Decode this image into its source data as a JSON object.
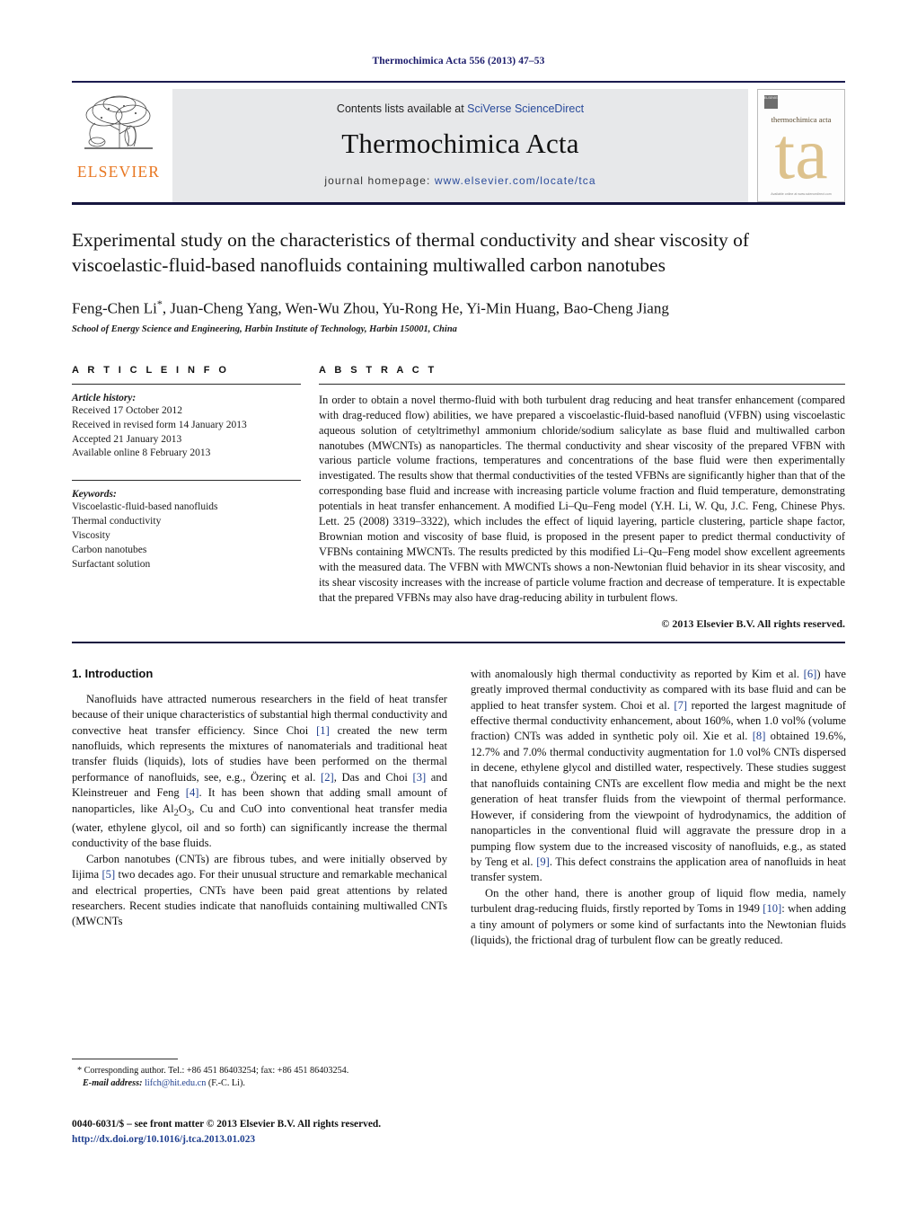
{
  "running_head": "Thermochimica Acta 556 (2013) 47–53",
  "masthead": {
    "publisher_name": "ELSEVIER",
    "publisher_logo_icon": "elsevier-tree-icon",
    "contents_prefix": "Contents lists available at ",
    "contents_link": "SciVerse ScienceDirect",
    "journal_name": "Thermochimica Acta",
    "homepage_prefix": "journal homepage: ",
    "homepage_link": "www.elsevier.com/locate/tca",
    "cover": {
      "badge_text": "ELSEVIER",
      "title": "thermochimica acta",
      "monogram": "ta",
      "footer": "Available online at www.sciencedirect.com"
    }
  },
  "article": {
    "title": "Experimental study on the characteristics of thermal conductivity and shear viscosity of viscoelastic-fluid-based nanofluids containing multiwalled carbon nanotubes",
    "authors": "Feng-Chen Li*, Juan-Cheng Yang, Wen-Wu Zhou, Yu-Rong He, Yi-Min Huang, Bao-Cheng Jiang",
    "affiliation": "School of Energy Science and Engineering, Harbin Institute of Technology, Harbin 150001, China"
  },
  "article_info": {
    "heading": "A R T I C L E   I N F O",
    "history_label": "Article history:",
    "history": [
      "Received 17 October 2012",
      "Received in revised form 14 January 2013",
      "Accepted 21 January 2013",
      "Available online 8 February 2013"
    ],
    "keywords_label": "Keywords:",
    "keywords": [
      "Viscoelastic-fluid-based nanofluids",
      "Thermal conductivity",
      "Viscosity",
      "Carbon nanotubes",
      "Surfactant solution"
    ]
  },
  "abstract": {
    "heading": "A B S T R A C T",
    "text": "In order to obtain a novel thermo-fluid with both turbulent drag reducing and heat transfer enhancement (compared with drag-reduced flow) abilities, we have prepared a viscoelastic-fluid-based nanofluid (VFBN) using viscoelastic aqueous solution of cetyltrimethyl ammonium chloride/sodium salicylate as base fluid and multiwalled carbon nanotubes (MWCNTs) as nanoparticles. The thermal conductivity and shear viscosity of the prepared VFBN with various particle volume fractions, temperatures and concentrations of the base fluid were then experimentally investigated. The results show that thermal conductivities of the tested VFBNs are significantly higher than that of the corresponding base fluid and increase with increasing particle volume fraction and fluid temperature, demonstrating potentials in heat transfer enhancement. A modified Li–Qu–Feng model (Y.H. Li, W. Qu, J.C. Feng, Chinese Phys. Lett. 25 (2008) 3319–3322), which includes the effect of liquid layering, particle clustering, particle shape factor, Brownian motion and viscosity of base fluid, is proposed in the present paper to predict thermal conductivity of VFBNs containing MWCNTs. The results predicted by this modified Li–Qu–Feng model show excellent agreements with the measured data. The VFBN with MWCNTs shows a non-Newtonian fluid behavior in its shear viscosity, and its shear viscosity increases with the increase of particle volume fraction and decrease of temperature. It is expectable that the prepared VFBNs may also have drag-reducing ability in turbulent flows.",
    "copyright": "© 2013 Elsevier B.V. All rights reserved."
  },
  "introduction": {
    "heading": "1.  Introduction",
    "left_paragraphs": [
      "Nanofluids have attracted numerous researchers in the field of heat transfer because of their unique characteristics of substantial high thermal conductivity and convective heat transfer efficiency. Since Choi [1] created the new term nanofluids, which represents the mixtures of nanomaterials and traditional heat transfer fluids (liquids), lots of studies have been performed on the thermal performance of nanofluids, see, e.g., Özerinç et al. [2], Das and Choi [3] and Kleinstreuer and Feng [4]. It has been shown that adding small amount of nanoparticles, like Al2O3, Cu and CuO into conventional heat transfer media (water, ethylene glycol, oil and so forth) can significantly increase the thermal conductivity of the base fluids.",
      "Carbon nanotubes (CNTs) are fibrous tubes, and were initially observed by Iijima [5] two decades ago. For their unusual structure and remarkable mechanical and electrical properties, CNTs have been paid great attentions by related researchers. Recent studies indicate that nanofluids containing multiwalled CNTs (MWCNTs"
    ],
    "right_paragraphs": [
      "with anomalously high thermal conductivity as reported by Kim et al. [6]) have greatly improved thermal conductivity as compared with its base fluid and can be applied to heat transfer system. Choi et al. [7] reported the largest magnitude of effective thermal conductivity enhancement, about 160%, when 1.0 vol% (volume fraction) CNTs was added in synthetic poly oil. Xie et al. [8] obtained 19.6%, 12.7% and 7.0% thermal conductivity augmentation for 1.0 vol% CNTs dispersed in decene, ethylene glycol and distilled water, respectively. These studies suggest that nanofluids containing CNTs are excellent flow media and might be the next generation of heat transfer fluids from the viewpoint of thermal performance. However, if considering from the viewpoint of hydrodynamics, the addition of nanoparticles in the conventional fluid will aggravate the pressure drop in a pumping flow system due to the increased viscosity of nanofluids, e.g., as stated by Teng et al. [9]. This defect constrains the application area of nanofluids in heat transfer system.",
      "On the other hand, there is another group of liquid flow media, namely turbulent drag-reducing fluids, firstly reported by Toms in 1949 [10]: when adding a tiny amount of polymers or some kind of surfactants into the Newtonian fluids (liquids), the frictional drag of turbulent flow can be greatly reduced."
    ]
  },
  "footnotes": {
    "corresponding_marker": "*",
    "corresponding_text": "Corresponding author. Tel.: +86 451 86403254; fax: +86 451 86403254.",
    "email_label": "E-mail address:",
    "email": "lifch@hit.edu.cn",
    "email_suffix": "(F.-C. Li)."
  },
  "imprint": {
    "issn_line": "0040-6031/$ – see front matter © 2013 Elsevier B.V. All rights reserved.",
    "doi": "http://dx.doi.org/10.1016/j.tca.2013.01.023"
  },
  "colors": {
    "link": "#1f3f8f",
    "elsevier_orange": "#e87722",
    "running_head": "#1b1b6b",
    "cover_tan": "#ddc28d"
  }
}
